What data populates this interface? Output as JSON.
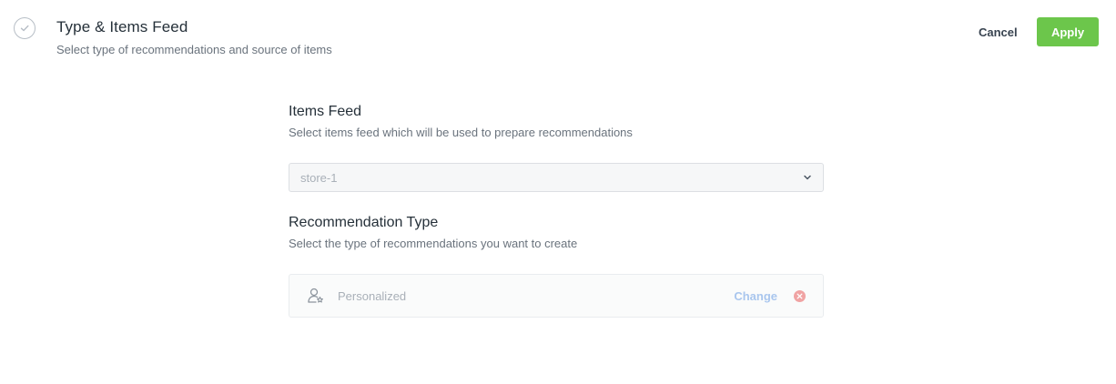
{
  "header": {
    "title": "Type & Items Feed",
    "subtitle": "Select type of recommendations and source of items",
    "step_icon": "check-circle-icon"
  },
  "actions": {
    "cancel_label": "Cancel",
    "apply_label": "Apply",
    "apply_color": "#6cc64b"
  },
  "items_feed": {
    "title": "Items Feed",
    "description": "Select items feed which will be used to prepare recommendations",
    "selected_value": "store-1",
    "dropdown_icon": "chevron-down-icon"
  },
  "recommendation_type": {
    "title": "Recommendation Type",
    "description": "Select the type of recommendations you want to create",
    "selected_label": "Personalized",
    "selected_icon": "user-star-icon",
    "change_label": "Change",
    "remove_icon": "remove-circle-icon",
    "change_color": "#a9c6ee",
    "remove_color": "#f0a3a3"
  }
}
